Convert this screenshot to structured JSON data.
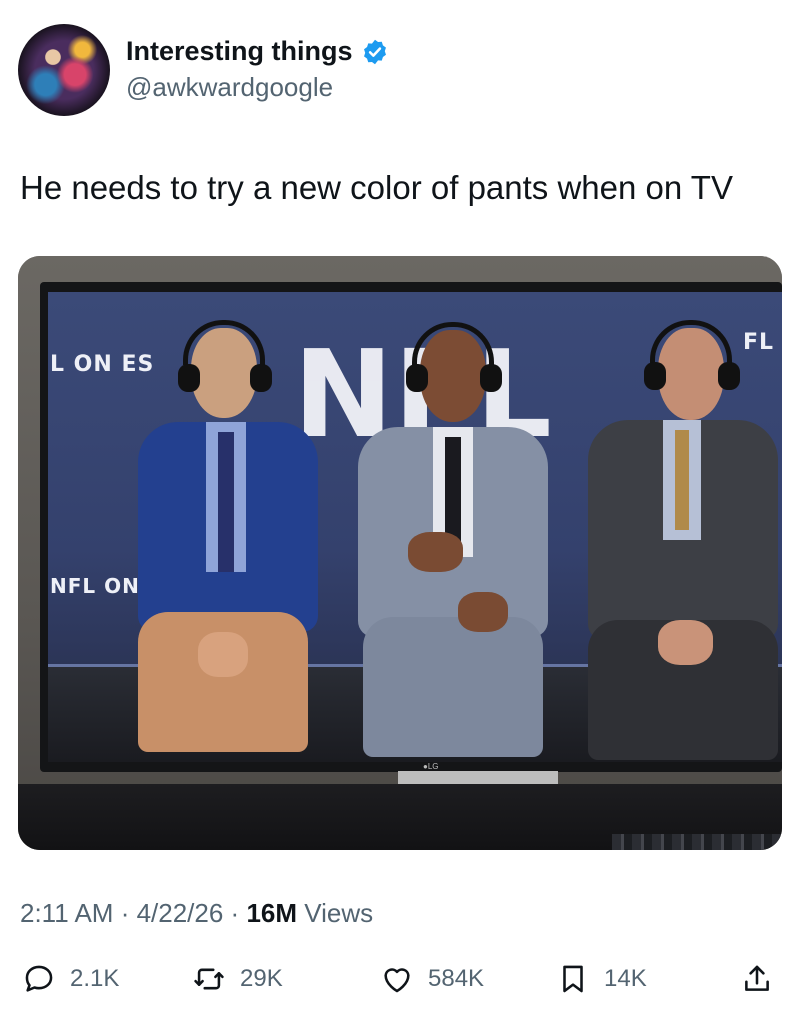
{
  "author": {
    "display_name": "Interesting things",
    "handle": "@awkwardgoogle",
    "verified": true
  },
  "tweet": {
    "text": "He needs to try a new color of pants when on TV"
  },
  "media": {
    "tv_overlay": {
      "left_text": "L ON ES",
      "left_lower_text": "NFL ON",
      "right_text": "FL",
      "logo_text": "NFL"
    }
  },
  "meta": {
    "time": "2:11 AM",
    "sep1": " · ",
    "date": "4/22/26",
    "sep2": " · ",
    "views_count": "16M",
    "views_label": " Views"
  },
  "actions": {
    "replies": "2.1K",
    "reposts": "29K",
    "likes": "584K",
    "bookmarks": "14K"
  },
  "colors": {
    "verified_blue": "#1d9bf0",
    "text_secondary": "#536471"
  }
}
